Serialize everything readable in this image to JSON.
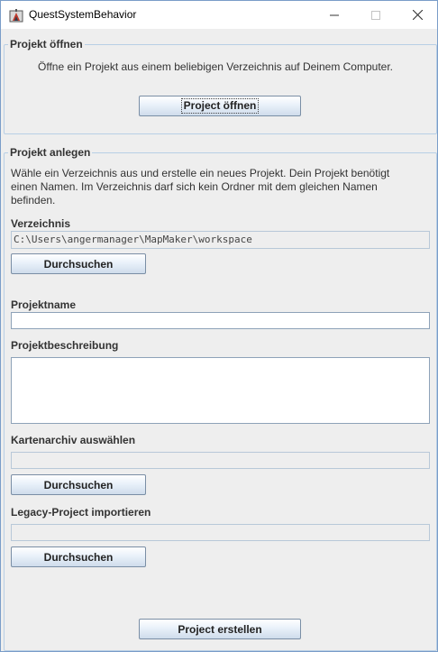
{
  "window": {
    "title": "QuestSystemBehavior",
    "icon": "app-icon"
  },
  "open_section": {
    "legend": "Projekt öffnen",
    "description": "Öffne ein Projekt aus einem beliebigen Verzeichnis auf Deinem Computer.",
    "open_button": "Project öffnen"
  },
  "create_section": {
    "legend": "Projekt anlegen",
    "description_line1": "Wähle ein Verzeichnis aus und erstelle ein neues Projekt. Dein Projekt benötigt",
    "description_line2": "einen Namen. Im Verzeichnis darf sich kein Ordner mit dem gleichen Namen",
    "description_line3": "befinden.",
    "directory_label": "Verzeichnis",
    "directory_value": "C:\\Users\\angermanager\\MapMaker\\workspace",
    "directory_browse": "Durchsuchen",
    "name_label": "Projektname",
    "name_value": "",
    "description_label": "Projektbeschreibung",
    "description_value": "",
    "map_archive_label": "Kartenarchiv auswählen",
    "map_archive_value": "",
    "map_archive_browse": "Durchsuchen",
    "legacy_label": "Legacy-Project importieren",
    "legacy_value": "",
    "legacy_browse": "Durchsuchen",
    "create_button": "Project erstellen"
  }
}
